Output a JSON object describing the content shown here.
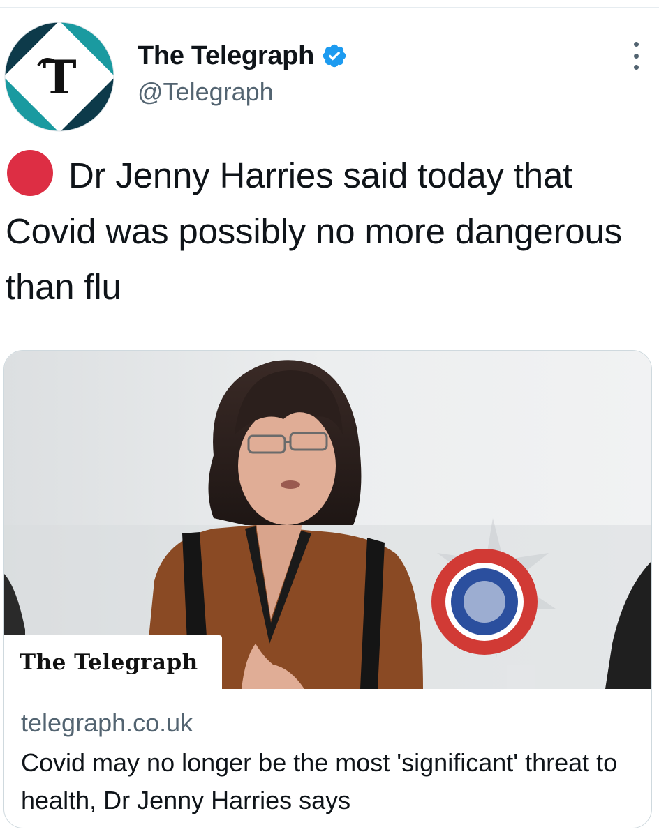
{
  "tweet": {
    "author": {
      "display_name": "The Telegraph",
      "handle": "@Telegraph",
      "verified": true,
      "avatar_icon": "telegraph-t-logo-icon",
      "verified_icon": "verified-badge-icon",
      "verified_color": "#1d9bf0"
    },
    "more_icon": "more-vertical-icon",
    "live_indicator_icon": "red-circle-icon",
    "live_indicator_color": "#dd2e44",
    "text": "Dr Jenny Harries said today that Covid was possibly no more dangerous than flu",
    "card": {
      "image_wordmark": "The Telegraph",
      "domain": "telegraph.co.uk",
      "title": "Covid may no longer be the most 'significant' threat to health, Dr Jenny Harries says"
    }
  },
  "colors": {
    "text_primary": "#0f1419",
    "text_secondary": "#536471",
    "border": "#cfd9de",
    "logo_teal": "#1a9aa0",
    "logo_dark": "#0d3a4a"
  }
}
